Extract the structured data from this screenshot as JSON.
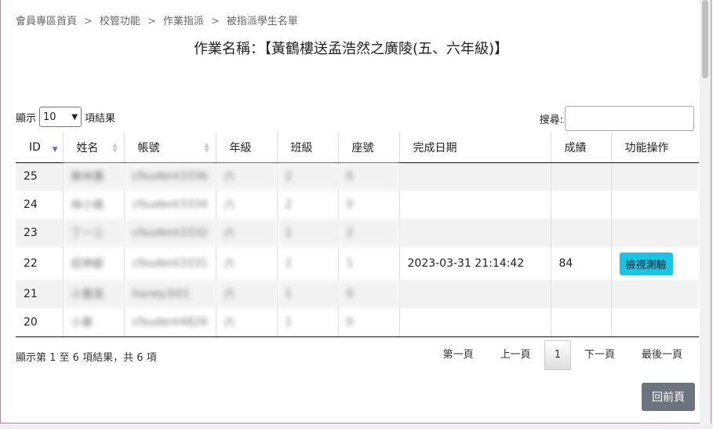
{
  "breadcrumb": [
    "會員專區首頁",
    "校管功能",
    "作業指派",
    "被指派學生名單"
  ],
  "breadcrumb_sep": ">",
  "title": "作業名稱：【黃鶴樓送孟浩然之廣陵(五、六年級)】",
  "length": {
    "prefix": "顯示",
    "value": "10",
    "suffix": "項結果"
  },
  "search": {
    "label": "搜尋:"
  },
  "table": {
    "headers": [
      "ID",
      "姓名",
      "帳號",
      "年級",
      "班級",
      "座號",
      "完成日期",
      "成績",
      "功能操作"
    ],
    "rows": [
      {
        "id": "25",
        "name": "蔡林蕙",
        "account": "cfsudent3336",
        "grade": "六",
        "class": "2",
        "seat": "0",
        "date": "",
        "score": "",
        "action": ""
      },
      {
        "id": "24",
        "name": "林小瑜",
        "account": "cfsudent3334",
        "grade": "六",
        "class": "2",
        "seat": "0",
        "date": "",
        "score": "",
        "action": ""
      },
      {
        "id": "23",
        "name": "丁一三",
        "account": "cfsudent3332",
        "grade": "六",
        "class": "1",
        "seat": "2",
        "date": "",
        "score": "",
        "action": ""
      },
      {
        "id": "22",
        "name": "莊伸叡",
        "account": "cfsudent3331",
        "grade": "六",
        "class": "1",
        "seat": "1",
        "date": "2023-03-31 21:14:42",
        "score": "84",
        "action": "檢視測驗"
      },
      {
        "id": "21",
        "name": "小豐英",
        "account": "honey3i01",
        "grade": "六",
        "class": "1",
        "seat": "0",
        "date": "",
        "score": "",
        "action": ""
      },
      {
        "id": "20",
        "name": "小慕",
        "account": "cfsudent4826",
        "grade": "六",
        "class": "1",
        "seat": "0",
        "date": "",
        "score": "",
        "action": ""
      }
    ]
  },
  "info": "顯示第 1 至 6 項結果，共 6 項",
  "pager": {
    "first": "第一頁",
    "prev": "上一頁",
    "current": "1",
    "next": "下一頁",
    "last": "最後一頁"
  },
  "back_button": "回前頁",
  "colors": {
    "accent": "#17c6e6",
    "back_button": "#6c757d"
  }
}
